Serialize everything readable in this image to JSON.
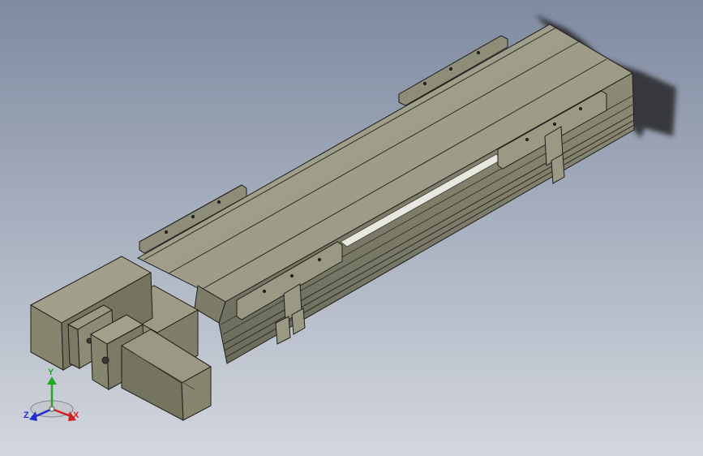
{
  "viewport": {
    "background_top": "#7f8aa0",
    "background_bottom": "#d3d7dd",
    "model_colors": {
      "top": "#a0a08a",
      "side": "#86866f",
      "dark": "#56564a",
      "edge": "#1e1e1a"
    }
  },
  "triad": {
    "y_label": "Y",
    "z_label": "Z",
    "x_label": "X",
    "colors": {
      "x": "#d42020",
      "y": "#22a822",
      "z": "#2030cc"
    }
  }
}
